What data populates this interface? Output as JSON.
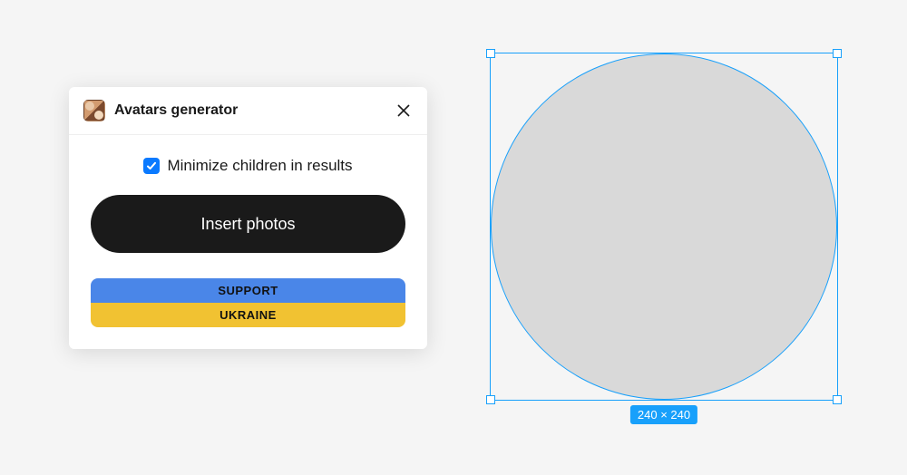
{
  "panel": {
    "title": "Avatars generator",
    "checkbox": {
      "label": "Minimize children in results",
      "checked": true
    },
    "primary_button": "Insert photos",
    "banner": {
      "line1": "SUPPORT",
      "line2": "UKRAINE"
    }
  },
  "canvas": {
    "selection_size": "240 × 240"
  },
  "colors": {
    "accent": "#18a0fb",
    "checkbox": "#0a7aff",
    "button_bg": "#1a1a1a",
    "banner_top": "#4a86e8",
    "banner_bottom": "#f1c232",
    "shape_fill": "#d9d9d9"
  }
}
